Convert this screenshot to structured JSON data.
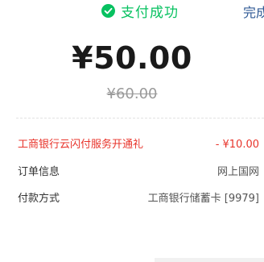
{
  "header": {
    "status_text": "支付成功",
    "done_label": "完成"
  },
  "payment": {
    "amount": "¥50.00",
    "original_amount": "¥60.00"
  },
  "details": [
    {
      "label": "工商银行云闪付服务开通礼",
      "value": "- ¥10.00"
    },
    {
      "label": "订单信息",
      "value": "网上国网"
    },
    {
      "label": "付款方式",
      "value": "工商银行储蓄卡 [9979]"
    }
  ],
  "colors": {
    "success": "#07c160",
    "discount": "#e8342b",
    "link": "#2f5a95"
  },
  "icons": {
    "status": "check-circle-icon"
  }
}
